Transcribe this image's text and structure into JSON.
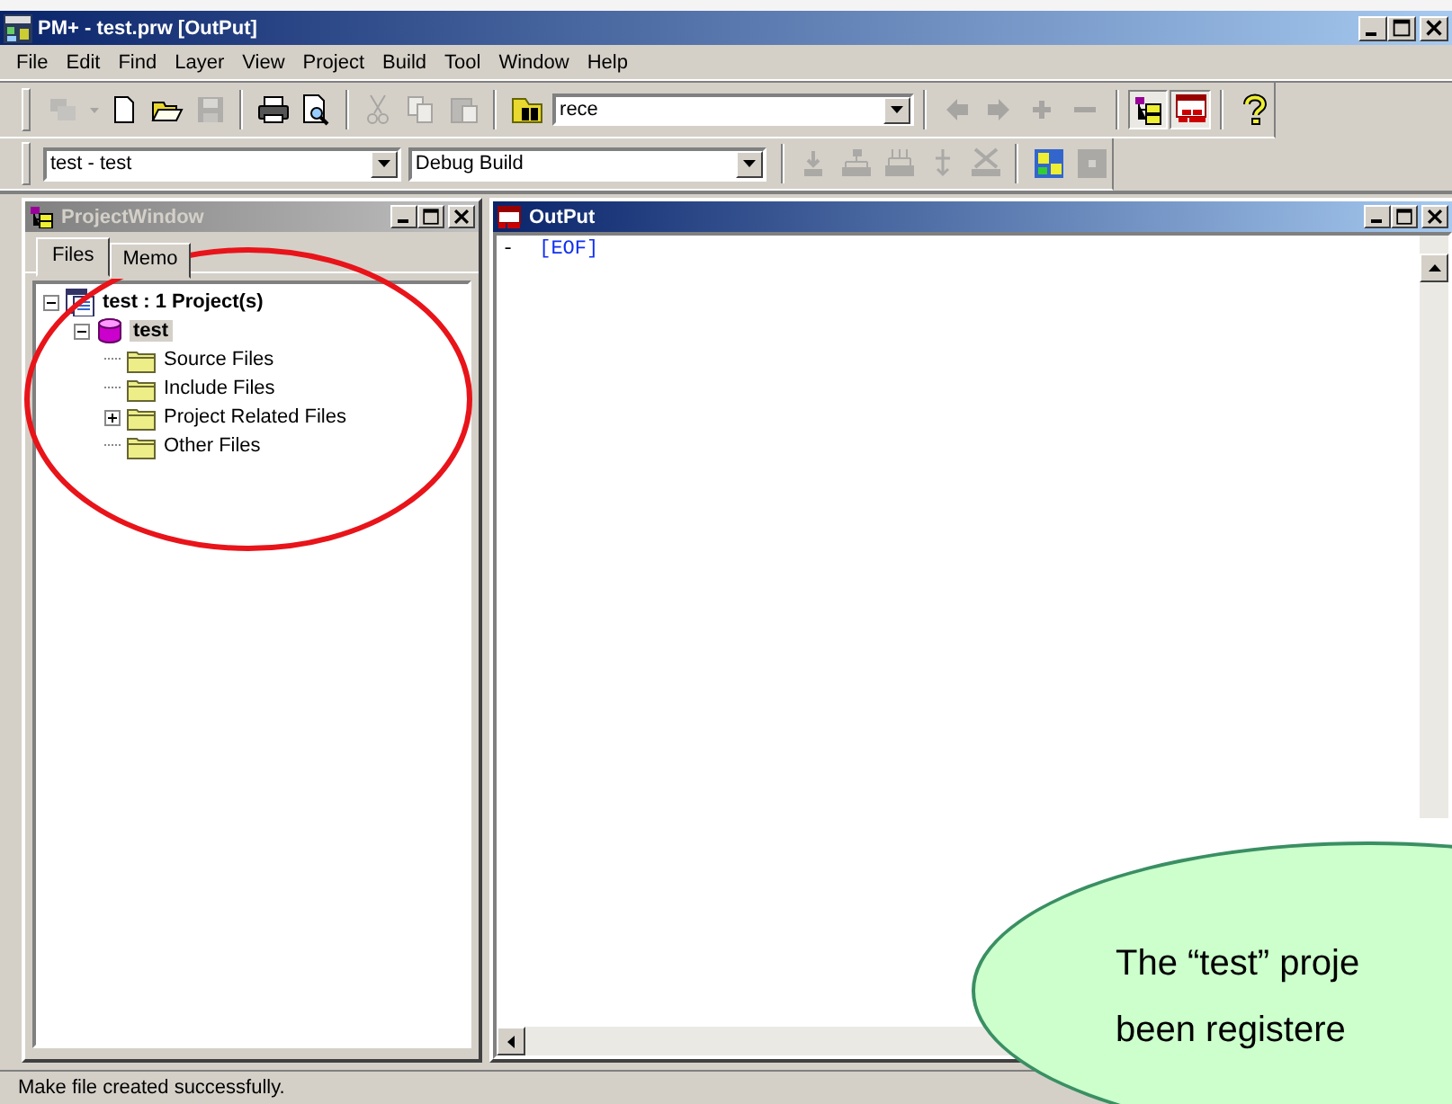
{
  "window": {
    "title": "PM+ - test.prw [OutPut]"
  },
  "menu": [
    {
      "label": "File"
    },
    {
      "label": "Edit"
    },
    {
      "label": "Find"
    },
    {
      "label": "Layer"
    },
    {
      "label": "View"
    },
    {
      "label": "Project"
    },
    {
      "label": "Build"
    },
    {
      "label": "Tool"
    },
    {
      "label": "Window"
    },
    {
      "label": "Help"
    }
  ],
  "toolbar_1": [
    {
      "kind": "button",
      "disabled": true,
      "pressed": false
    },
    {
      "kind": "caret",
      "disabled": true,
      "pressed": false
    },
    {
      "kind": "button",
      "disabled": false,
      "pressed": false
    },
    {
      "kind": "button",
      "disabled": false,
      "pressed": false
    },
    {
      "kind": "button",
      "disabled": true,
      "pressed": false
    },
    {
      "kind": "separator"
    },
    {
      "kind": "button",
      "disabled": false,
      "pressed": false
    },
    {
      "kind": "button",
      "disabled": false,
      "pressed": false
    },
    {
      "kind": "separator"
    },
    {
      "kind": "button",
      "disabled": true,
      "pressed": false
    },
    {
      "kind": "button",
      "disabled": true,
      "pressed": false
    },
    {
      "kind": "button",
      "disabled": true,
      "pressed": false
    },
    {
      "kind": "separator"
    },
    {
      "kind": "button",
      "disabled": false,
      "pressed": false
    },
    {
      "kind": "combo",
      "value": "rece"
    },
    {
      "kind": "separator"
    },
    {
      "kind": "button",
      "disabled": true,
      "pressed": false
    },
    {
      "kind": "button",
      "disabled": true,
      "pressed": false
    },
    {
      "kind": "button",
      "disabled": true,
      "pressed": false
    },
    {
      "kind": "button",
      "disabled": true,
      "pressed": false
    },
    {
      "kind": "separator"
    },
    {
      "kind": "button",
      "disabled": false,
      "pressed": true
    },
    {
      "kind": "button",
      "disabled": false,
      "pressed": true
    },
    {
      "kind": "separator"
    },
    {
      "kind": "button",
      "disabled": false,
      "pressed": false
    }
  ],
  "toolbar_2": [
    {
      "kind": "combo",
      "value": "test - test"
    },
    {
      "kind": "combo",
      "value": "Debug Build"
    },
    {
      "kind": "separator"
    },
    {
      "kind": "button",
      "disabled": true,
      "pressed": false
    },
    {
      "kind": "button",
      "disabled": true,
      "pressed": false
    },
    {
      "kind": "button",
      "disabled": true,
      "pressed": false
    },
    {
      "kind": "button",
      "disabled": true,
      "pressed": false
    },
    {
      "kind": "button",
      "disabled": true,
      "pressed": false
    },
    {
      "kind": "separator"
    },
    {
      "kind": "button",
      "disabled": false,
      "pressed": false
    },
    {
      "kind": "button",
      "disabled": true,
      "pressed": false
    }
  ],
  "project_window": {
    "title": "ProjectWindow",
    "active": false,
    "tabs": [
      {
        "label": "Files",
        "selected": true
      },
      {
        "label": "Memo",
        "selected": false
      }
    ],
    "tree": [
      {
        "label": "test : 1 Project(s)",
        "kind": "workspace",
        "selected": false,
        "expanded": true,
        "children": [
          {
            "label": "test",
            "kind": "project",
            "selected": true,
            "expanded": true,
            "children": [
              {
                "label": "Source Files",
                "kind": "folder",
                "selected": false
              },
              {
                "label": "Include Files",
                "kind": "folder",
                "selected": false
              },
              {
                "label": "Project Related Files",
                "kind": "folder",
                "selected": false,
                "expanded": false
              },
              {
                "label": "Other Files",
                "kind": "folder",
                "selected": false
              }
            ]
          }
        ]
      }
    ]
  },
  "output_window": {
    "title": "OutPut",
    "active": true,
    "lines": [
      {
        "marker": "-",
        "text": "[EOF]"
      }
    ]
  },
  "status_bar": {
    "text": "Make file created successfully."
  },
  "callout": {
    "lines": [
      "The “test” proje",
      "been registere"
    ]
  }
}
